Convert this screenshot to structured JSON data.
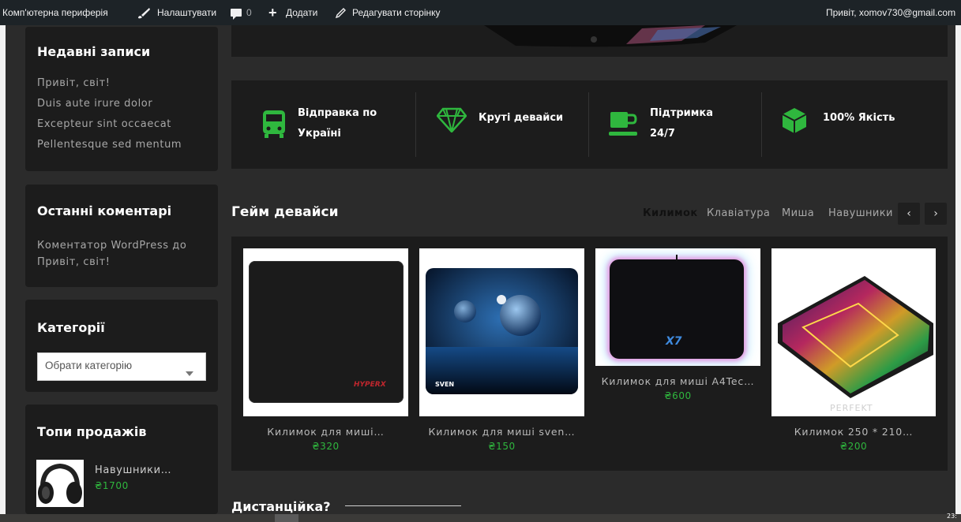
{
  "adminbar": {
    "site_name": "Комп'ютерна периферія",
    "customize": "Налаштувати",
    "comments_count": "0",
    "add_new": "Додати",
    "edit_page": "Редагувати сторінку",
    "greeting": "Привіт, xomov730@gmail.com"
  },
  "sidebar": {
    "recent_posts": {
      "title": "Недавні записи",
      "items": [
        "Привіт, світ!",
        "Duis aute irure dolor",
        "Excepteur sint occaecat",
        "Pellentesque sed mentum"
      ]
    },
    "recent_comments": {
      "title": "Останні коментарі",
      "line1": "Коментатор WordPress до",
      "line2": "Привіт, світ!"
    },
    "categories": {
      "title": "Категорії",
      "select_value": "Обрати категорію"
    },
    "top_sales": {
      "title": "Топи продажів",
      "item_name": "Навушники…",
      "item_price": "₴1700"
    }
  },
  "features": [
    {
      "icon": "bus-icon",
      "line1": "Відправка по",
      "line2": "Україні"
    },
    {
      "icon": "diamond-icon",
      "line1": "Круті девайси",
      "line2": ""
    },
    {
      "icon": "coffee-cup-icon",
      "line1": "Підтримка",
      "line2": "24/7"
    },
    {
      "icon": "cube-icon",
      "line1": "100% Якість",
      "line2": ""
    }
  ],
  "products_section": {
    "title": "Гейм девайси",
    "tabs": [
      "Килимок",
      "Клавіатура",
      "Миша",
      "Навушники"
    ],
    "active_tab": "Килимок",
    "prev": "‹",
    "next": "›",
    "products": [
      {
        "name": "Килимок для миші…",
        "price": "₴320",
        "image_text": "HYPERX"
      },
      {
        "name": "Килимок для миші sven…",
        "price": "₴150",
        "image_text": "SVEN"
      },
      {
        "name": "Килимок для миші A4Tec…",
        "price": "₴600",
        "image_text": "X7"
      },
      {
        "name": "Килимок 250 * 210…",
        "price": "₴200",
        "image_text": "PERFEKT"
      }
    ]
  },
  "next_section": {
    "title": "Дистанційка?"
  },
  "taskbar": {
    "clock": "23:"
  },
  "colors": {
    "accent_green": "#2fb73e",
    "panel": "#1c1c1c",
    "background": "#2b2b2b",
    "adminbar": "#1d2327"
  }
}
